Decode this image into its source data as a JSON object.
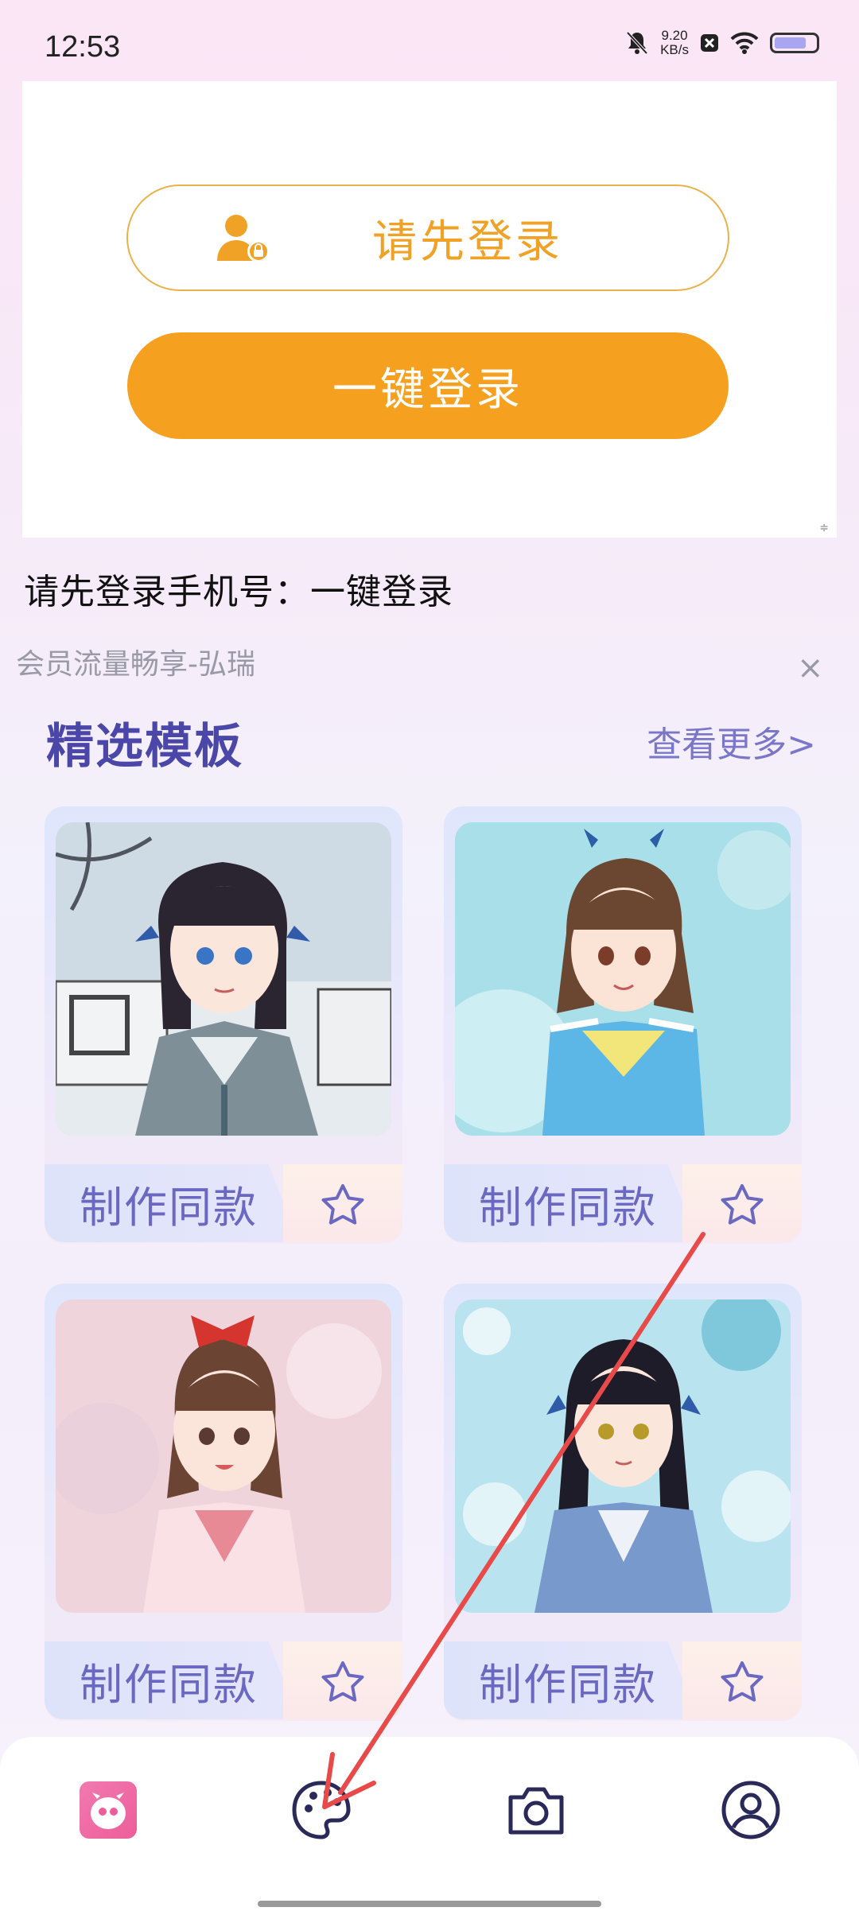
{
  "status_bar": {
    "time": "12:53",
    "speed_value": "9.20",
    "speed_unit": "KB/s"
  },
  "login": {
    "prompt_label": "请先登录",
    "onekey_label": "一键登录",
    "hint": "请先登录手机号：一键登录"
  },
  "member_text": "会员流量畅享-弘瑞",
  "close_symbol": "×",
  "templates": {
    "title": "精选模板",
    "see_more": "查看更多>",
    "cards": [
      {
        "label": "制作同款"
      },
      {
        "label": "制作同款"
      },
      {
        "label": "制作同款"
      },
      {
        "label": "制作同款"
      }
    ]
  },
  "nav": [
    "home-icon",
    "palette-icon",
    "camera-icon",
    "profile-icon"
  ],
  "colors": {
    "accent_orange": "#f6a01f",
    "accent_purple": "#6b68c2",
    "arrow": "#e84a4a"
  }
}
